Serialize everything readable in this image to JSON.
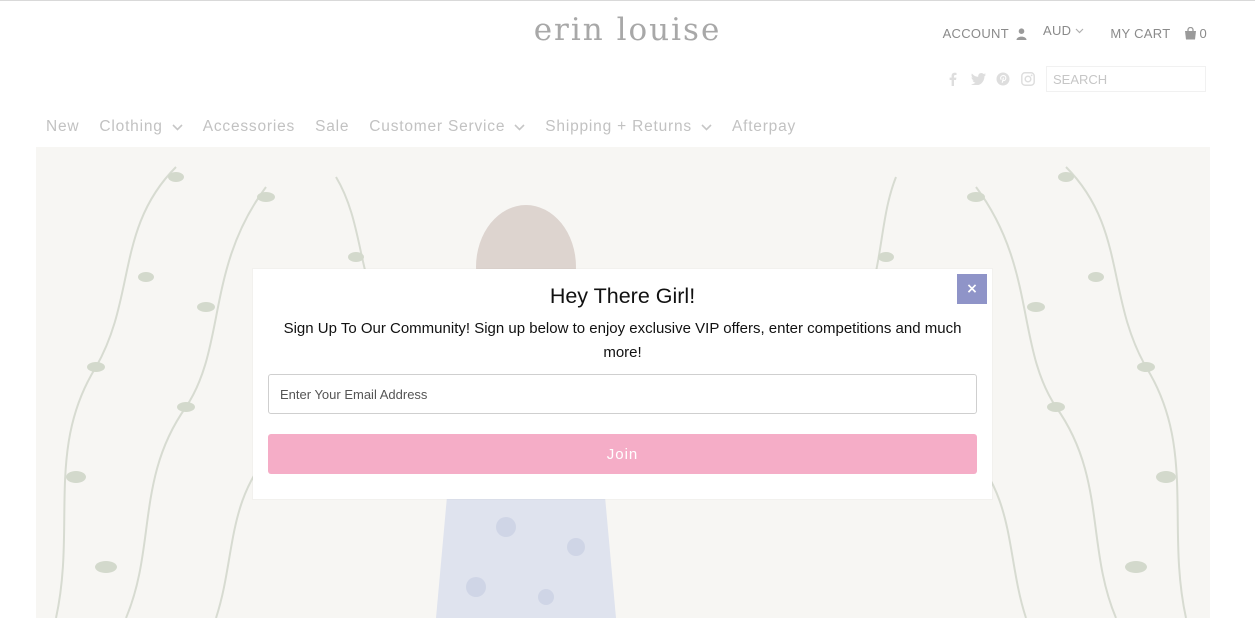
{
  "header": {
    "logo": "erin louise",
    "account_label": "ACCOUNT",
    "currency": "AUD",
    "cart_label": "MY CART",
    "cart_count": "0",
    "search_placeholder": "SEARCH",
    "social_icons": [
      "facebook-icon",
      "twitter-icon",
      "pinterest-icon",
      "instagram-icon"
    ]
  },
  "nav": {
    "items": [
      {
        "label": "New",
        "dropdown": false
      },
      {
        "label": "Clothing",
        "dropdown": true
      },
      {
        "label": "Accessories",
        "dropdown": false
      },
      {
        "label": "Sale",
        "dropdown": false
      },
      {
        "label": "Customer Service",
        "dropdown": true
      },
      {
        "label": "Shipping + Returns",
        "dropdown": true
      },
      {
        "label": "Afterpay",
        "dropdown": false
      }
    ]
  },
  "popup": {
    "title": "Hey There Girl!",
    "description": "Sign Up To Our Community! Sign up below to enjoy exclusive VIP offers, enter competitions and much more!",
    "email_placeholder": "Enter Your Email Address",
    "button_label": "Join",
    "close_symbol": "×"
  },
  "colors": {
    "close_bg": "#8f94c8",
    "join_bg": "#f5adc7",
    "muted_text": "#8a8a8a"
  }
}
